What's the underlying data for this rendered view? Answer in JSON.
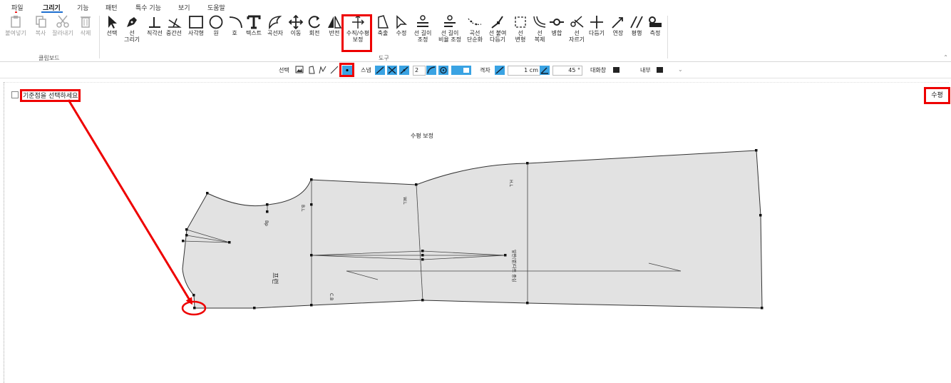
{
  "menu": {
    "items": [
      "파일",
      "그리기",
      "기능",
      "패턴",
      "특수 기능",
      "보기",
      "도움말"
    ],
    "active": "그리기"
  },
  "ribbon": {
    "clipboard_group": "클립보드",
    "tools_group": "도구",
    "clipboard": [
      "붙여넣기",
      "복사",
      "잘라내기",
      "삭제"
    ],
    "tools": [
      {
        "label": "선택",
        "icon": "pointer-icon"
      },
      {
        "label": "선\n그리기",
        "icon": "pen-icon"
      },
      {
        "label": "직각선",
        "icon": "right-angle-icon"
      },
      {
        "label": "중간선",
        "icon": "middle-line-icon"
      },
      {
        "label": "사각형",
        "icon": "rectangle-icon"
      },
      {
        "label": "원",
        "icon": "circle-icon"
      },
      {
        "label": "호",
        "icon": "arc-icon"
      },
      {
        "label": "텍스트",
        "icon": "text-icon"
      },
      {
        "label": "곡선자",
        "icon": "french-curve-icon"
      },
      {
        "label": "이동",
        "icon": "move-icon"
      },
      {
        "label": "회전",
        "icon": "rotate-icon"
      },
      {
        "label": "반전",
        "icon": "flip-icon"
      },
      {
        "label": "수직/수평\n보정",
        "icon": "vertical-horizontal-icon"
      },
      {
        "label": "축출",
        "icon": "extract-icon"
      },
      {
        "label": "수정",
        "icon": "edit-icon"
      },
      {
        "label": "선 길이\n조정",
        "icon": "line-length-icon"
      },
      {
        "label": "선 길이\n비율 조정",
        "icon": "line-ratio-icon"
      },
      {
        "label": "곡선\n단순화",
        "icon": "simplify-curve-icon"
      },
      {
        "label": "선 붙여\n다듬기",
        "icon": "attach-line-icon"
      },
      {
        "label": "선\n변형",
        "icon": "deform-line-icon"
      },
      {
        "label": "선\n복제",
        "icon": "duplicate-line-icon"
      },
      {
        "label": "병합",
        "icon": "merge-icon"
      },
      {
        "label": "선\n자르기",
        "icon": "cut-line-icon"
      },
      {
        "label": "다듬기",
        "icon": "trim-icon"
      },
      {
        "label": "연장",
        "icon": "extend-icon"
      },
      {
        "label": "평행",
        "icon": "parallel-icon"
      },
      {
        "label": "측정",
        "icon": "tape-measure-icon"
      }
    ]
  },
  "optbar": {
    "select_label": "선택",
    "snap_label": "스냅",
    "snap_value": "2",
    "grid_label": "격자",
    "grid_value": "1 cm",
    "angle_value": "45 °",
    "dialog_label": "대화창",
    "inner_label": "내부"
  },
  "canvas": {
    "prompt": "기준점을 선택하세요.",
    "mode": "수평",
    "title": "수평 보정",
    "labels": {
      "bp": "Bp",
      "bl": "B.L",
      "wl": "W.L",
      "hl": "H.L",
      "cb": "C.B",
      "front": "프런",
      "side": "앞판(옆)다트 중심"
    }
  },
  "colors": {
    "highlight": "#e00000",
    "accent": "#3aa3e3",
    "pattern_fill": "#e2e2e2"
  }
}
